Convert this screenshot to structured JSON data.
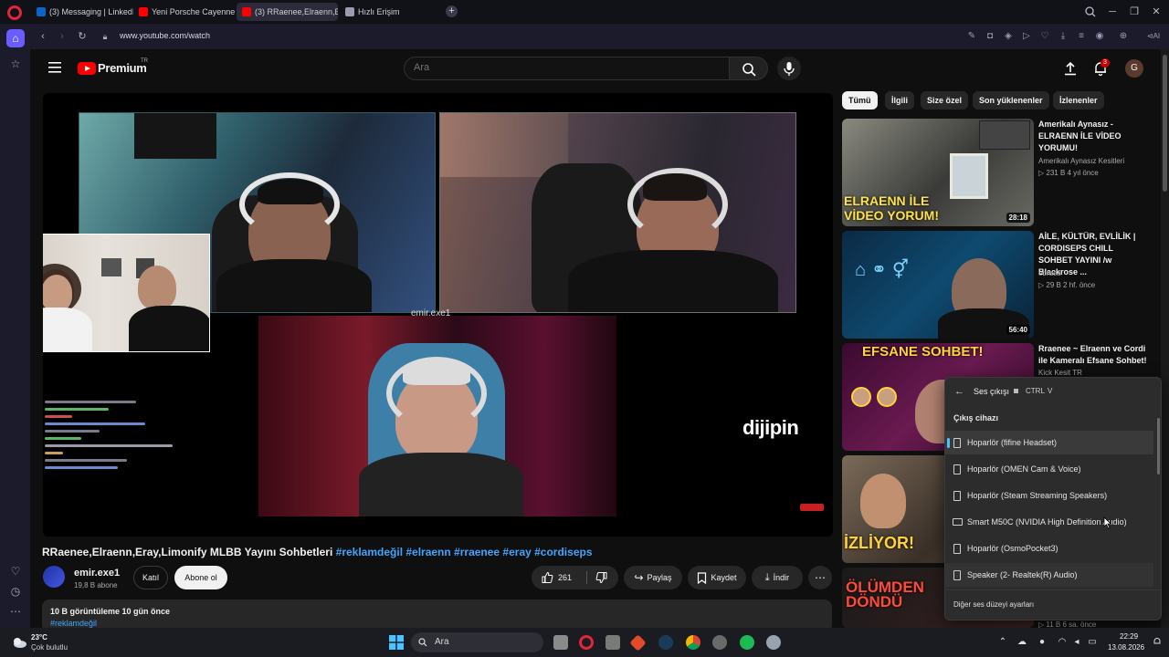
{
  "browser": {
    "tabs": [
      {
        "label": "(3) Messaging | LinkedIn",
        "favicon_color": "#0a66c2"
      },
      {
        "label": "Yeni Porsche Cayenne Tur",
        "favicon_color": "#ff0000"
      },
      {
        "label": "(3) RRaenee,Elraenn,E",
        "favicon_color": "#ff0000"
      },
      {
        "label": "Hızlı Erişim",
        "favicon_color": "#9a9ab0"
      }
    ],
    "url": "www.youtube.com/watch"
  },
  "youtube": {
    "logo_text": "Premium",
    "logo_sup": "TR",
    "search_placeholder": "Ara",
    "notif_count": "3",
    "avatar_letter": "G",
    "chips": [
      "Tümü",
      "İlgili",
      "Size özel",
      "Son yüklenenler",
      "İzlenenler"
    ]
  },
  "video": {
    "cam_label": "emir.exe1",
    "watermark": "dijipin",
    "title_main": "RRaenee,Elraenn,Eray,Limonify MLBB Yayını Sohbetleri",
    "title_tags": "#reklamdeğil #elraenn #rraenee #eray #cordiseps",
    "channel_name": "emir.exe1",
    "channel_subs": "19,8 B abone",
    "join_label": "Katıl",
    "subscribe_label": "Abone ol",
    "likes": "261",
    "share_label": "Paylaş",
    "save_label": "Kaydet",
    "download_label": "İndir",
    "views_line": "10 B görüntüleme  10 gün önce",
    "desc_tag": "#reklamdeğil"
  },
  "recommended": [
    {
      "title": "Amerikalı Aynasız - ELRAENN İLE VİDEO YORUMU!",
      "channel": "Amerikalı Aynasız Kesitleri",
      "meta": "▷ 231 B  4 yıl önce",
      "duration": "28:18",
      "thumb_text": "ELRAENN İLE VİDEO YORUM!"
    },
    {
      "title": "AİLE, KÜLTÜR, EVLİLİK | CORDISEPS CHILL SOHBET YAYINI /w Blackrose ...",
      "channel": "ebruca",
      "meta": "▷ 29 B  2 hf. önce",
      "duration": "56:40",
      "thumb_text": ""
    },
    {
      "title": "Rraenee ~ Elraenn ve Cordi ile Kameralı Efsane Sohbet!",
      "channel": "Kick Kesit TR",
      "meta": "",
      "duration": "",
      "thumb_text": "EFSANE SOHBET!"
    },
    {
      "title": "",
      "channel": "",
      "meta": "",
      "duration": "",
      "thumb_text": "İZLİYOR!"
    },
    {
      "title": "",
      "channel": "",
      "meta": "▷ 11 B  6 sa. önce",
      "duration": "",
      "thumb_text": "ÖLÜMDEN DÖNDÜ"
    }
  ],
  "audio_panel": {
    "title": "Ses çıkışı",
    "shortcut_key": "CTRL",
    "shortcut_letter": "V",
    "section": "Çıkış cihazı",
    "devices": [
      "Hoparlör (fifine Headset)",
      "Hoparlör (OMEN Cam & Voice)",
      "Hoparlör (Steam Streaming Speakers)",
      "Smart M50C (NVIDIA High Definition Audio)",
      "Hoparlör (OsmoPocket3)",
      "Speaker (2- Realtek(R) Audio)"
    ],
    "more_label": "Diğer ses düzeyi ayarları"
  },
  "taskbar": {
    "weather_temp": "23°C",
    "weather_desc": "Çok bulutlu",
    "search_label": "Ara",
    "time": "22:29",
    "date": "13.08.2026"
  }
}
